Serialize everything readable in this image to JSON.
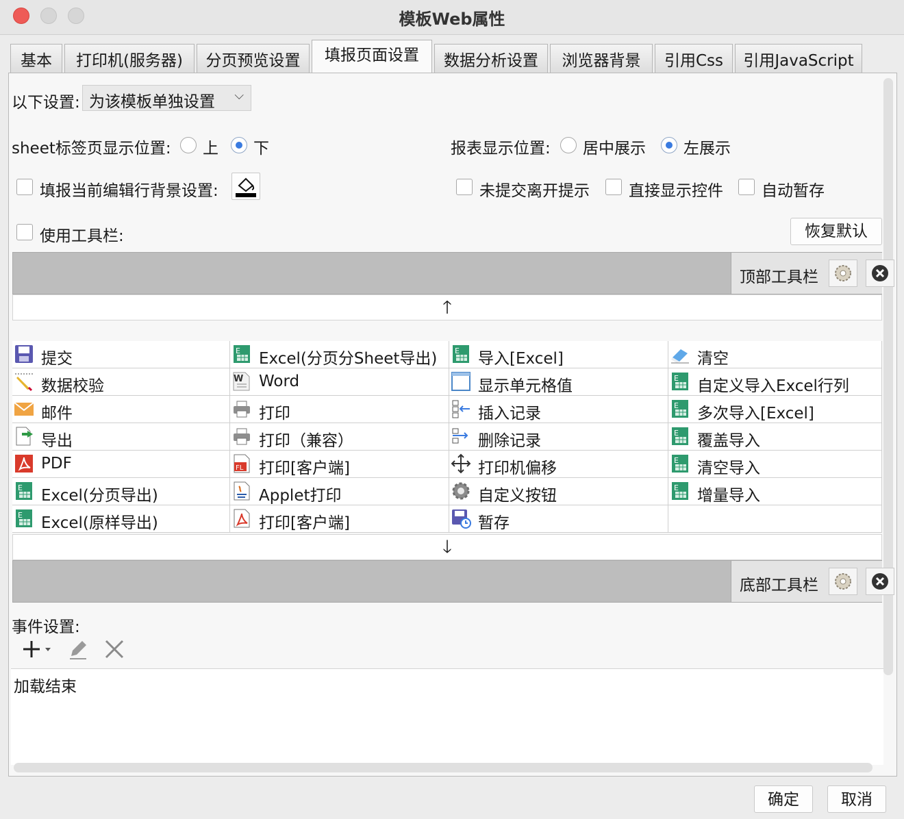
{
  "window": {
    "title": "模板Web属性"
  },
  "tabs": [
    "基本",
    "打印机(服务器)",
    "分页预览设置",
    "填报页面设置",
    "数据分析设置",
    "浏览器背景",
    "引用Css",
    "引用JavaScript"
  ],
  "active_tab": "填报页面设置",
  "settings": {
    "scope_label": "以下设置:",
    "scope_value": "为该模板单独设置",
    "sheet_label": "sheet标签页显示位置:",
    "sheet_top": "上",
    "sheet_bottom": "下",
    "sheet_selected": "下",
    "report_pos_label": "报表显示位置:",
    "report_center": "居中展示",
    "report_left": "左展示",
    "report_selected": "左展示",
    "edit_row_bg_label": "填报当前编辑行背景设置:",
    "unsubmitted_label": "未提交离开提示",
    "show_widget_label": "直接显示控件",
    "autosave_label": "自动暂存",
    "use_toolbar_label": "使用工具栏:",
    "restore_default": "恢复默认"
  },
  "top_toolbar": {
    "label": "顶部工具栏"
  },
  "bottom_toolbar": {
    "label": "底部工具栏"
  },
  "buttons": [
    [
      {
        "label": "提交",
        "icon": "submit-save-icon"
      },
      {
        "label": "数据校验",
        "icon": "pencil-validate-icon"
      },
      {
        "label": "邮件",
        "icon": "mail-icon"
      },
      {
        "label": "导出",
        "icon": "export-icon"
      },
      {
        "label": "PDF",
        "icon": "pdf-icon"
      },
      {
        "label": "Excel(分页导出)",
        "icon": "excel-icon"
      },
      {
        "label": "Excel(原样导出)",
        "icon": "excel-icon"
      }
    ],
    [
      {
        "label": "Excel(分页分Sheet导出)",
        "icon": "excel-icon"
      },
      {
        "label": "Word",
        "icon": "word-icon"
      },
      {
        "label": "打印",
        "icon": "printer-icon"
      },
      {
        "label": "打印（兼容）",
        "icon": "printer-icon"
      },
      {
        "label": "打印[客户端]",
        "icon": "flash-print-icon"
      },
      {
        "label": "Applet打印",
        "icon": "java-applet-icon"
      },
      {
        "label": "打印[客户端]",
        "icon": "pdf-print-icon"
      }
    ],
    [
      {
        "label": "导入[Excel]",
        "icon": "excel-icon"
      },
      {
        "label": "显示单元格值",
        "icon": "cell-value-icon"
      },
      {
        "label": "插入记录",
        "icon": "insert-row-icon"
      },
      {
        "label": "删除记录",
        "icon": "delete-row-icon"
      },
      {
        "label": "打印机偏移",
        "icon": "move-offset-icon"
      },
      {
        "label": "自定义按钮",
        "icon": "gear-icon"
      },
      {
        "label": "暂存",
        "icon": "temp-save-icon"
      }
    ],
    [
      {
        "label": "清空",
        "icon": "eraser-icon"
      },
      {
        "label": "自定义导入Excel行列",
        "icon": "excel-icon"
      },
      {
        "label": "多次导入[Excel]",
        "icon": "excel-icon"
      },
      {
        "label": "覆盖导入",
        "icon": "excel-icon"
      },
      {
        "label": "清空导入",
        "icon": "excel-icon"
      },
      {
        "label": "增量导入",
        "icon": "excel-icon"
      },
      {
        "label": "",
        "icon": ""
      }
    ]
  ],
  "events": {
    "label": "事件设置:",
    "items": [
      "加载结束"
    ]
  },
  "footer": {
    "ok": "确定",
    "cancel": "取消"
  },
  "colors": {
    "excel_green": "#2e9a6e",
    "pdf_red": "#d93a2b",
    "toolbar_gray": "#bdbdbd",
    "radio_blue": "#3a7be0"
  }
}
